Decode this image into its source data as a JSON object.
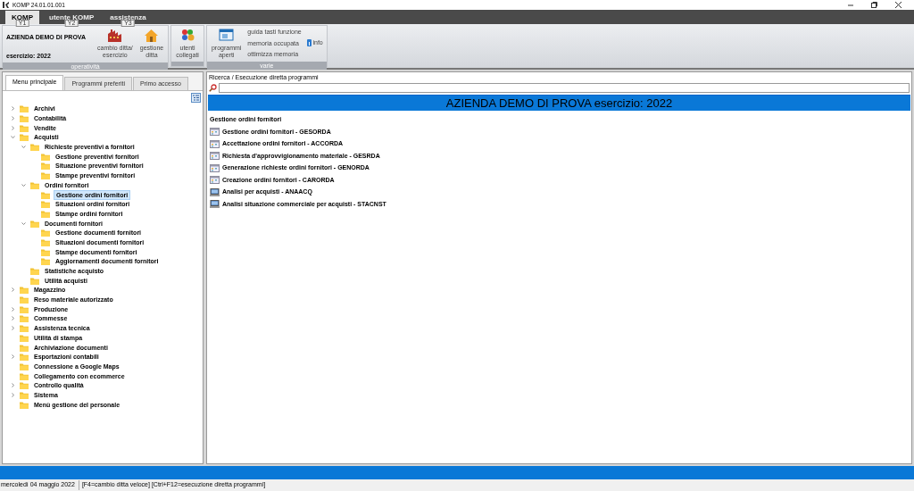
{
  "window": {
    "title": "KOMP 24.01.01.001"
  },
  "menu_tabs": [
    {
      "label": "KOMP",
      "key_tip": "Y1",
      "selected": true
    },
    {
      "label": "utente KOMP",
      "key_tip": "Y2",
      "selected": false
    },
    {
      "label": "assistenza",
      "key_tip": "Y3",
      "selected": false
    }
  ],
  "ribbon": {
    "company": "AZIENDA DEMO DI PROVA",
    "year": "esercizio: 2022",
    "groups": [
      {
        "caption": "operatività",
        "buttons": [
          {
            "kind": "factory",
            "label_lines": [
              "cambio ditta/",
              "esercizio"
            ]
          },
          {
            "kind": "house",
            "label_lines": [
              "gestione",
              "ditta"
            ]
          }
        ]
      },
      {
        "buttons": [
          {
            "kind": "users",
            "label_lines": [
              "utenti",
              "collegati"
            ]
          }
        ]
      },
      {
        "caption": "varie",
        "buttons": [
          {
            "kind": "window",
            "label_lines": [
              "programmi",
              "aperti"
            ]
          }
        ],
        "links": [
          "guida tasti funzione",
          "memoria occupata",
          "ottimizza memoria"
        ],
        "info": "info"
      }
    ]
  },
  "left_tabs": [
    {
      "label": "Menu principale",
      "selected": true
    },
    {
      "label": "Programmi preferiti",
      "selected": false
    },
    {
      "label": "Primo accesso",
      "selected": false
    }
  ],
  "tree": [
    {
      "label": "Archivi",
      "expanded": false,
      "selected": false
    },
    {
      "label": "Contabilità",
      "expanded": false,
      "selected": false
    },
    {
      "label": "Vendite",
      "expanded": false,
      "selected": false
    },
    {
      "label": "Acquisti",
      "expanded": true,
      "selected": false,
      "children": [
        {
          "label": "Richieste preventivi a fornitori",
          "expanded": true,
          "selected": false,
          "children": [
            {
              "label": "Gestione preventivi fornitori",
              "selected": false
            },
            {
              "label": "Situazione preventivi fornitori",
              "selected": false
            },
            {
              "label": "Stampe preventivi fornitori",
              "selected": false
            }
          ]
        },
        {
          "label": "Ordini fornitori",
          "expanded": true,
          "selected": false,
          "children": [
            {
              "label": "Gestione ordini fornitori",
              "selected": true
            },
            {
              "label": "Situazioni ordini fornitori",
              "selected": false
            },
            {
              "label": "Stampe ordini fornitori",
              "selected": false
            }
          ]
        },
        {
          "label": "Documenti fornitori",
          "expanded": true,
          "selected": false,
          "children": [
            {
              "label": "Gestione documenti fornitori",
              "selected": false
            },
            {
              "label": "Situazioni documenti fornitori",
              "selected": false
            },
            {
              "label": "Stampe documenti fornitori",
              "selected": false
            },
            {
              "label": "Aggiornamenti documenti fornitori",
              "selected": false
            }
          ]
        },
        {
          "label": "Statistiche acquisto",
          "selected": false
        },
        {
          "label": "Utilità acquisti",
          "selected": false
        }
      ]
    },
    {
      "label": "Magazzino",
      "expanded": false,
      "selected": false
    },
    {
      "label": "Reso materiale autorizzato",
      "selected": false
    },
    {
      "label": "Produzione",
      "expanded": false,
      "selected": false
    },
    {
      "label": "Commesse",
      "expanded": false,
      "selected": false
    },
    {
      "label": "Assistenza tecnica",
      "expanded": false,
      "selected": false
    },
    {
      "label": "Utilità di stampa",
      "selected": false
    },
    {
      "label": "Archiviazione documenti",
      "selected": false
    },
    {
      "label": "Esportazioni contabili",
      "expanded": false,
      "selected": false
    },
    {
      "label": "Connessione a Google Maps",
      "selected": false
    },
    {
      "label": "Collegamento con ecommerce",
      "selected": false
    },
    {
      "label": "Controllo qualità",
      "expanded": false,
      "selected": false
    },
    {
      "label": "Sistema",
      "expanded": false,
      "selected": false
    },
    {
      "label": "Menù gestione del personale",
      "selected": false
    }
  ],
  "search": {
    "label": "Ricerca / Esecuzione diretta programmi"
  },
  "banner": "AZIENDA DEMO DI PROVA  esercizio: 2022",
  "section_title": "Gestione ordini fornitori",
  "programs": [
    {
      "kind": "form",
      "label": "Gestione ordini fornitori - GESORDA"
    },
    {
      "kind": "form",
      "label": "Accettazione ordini fornitori - ACCORDA"
    },
    {
      "kind": "form",
      "label": "Richiesta d'approvvigionamento materiale - GESRDA"
    },
    {
      "kind": "form",
      "label": "Generazione richieste ordini fornitori - GENORDA"
    },
    {
      "kind": "form",
      "label": "Creazione ordini fornitori - CARORDA"
    },
    {
      "kind": "report",
      "label": "Analisi per acquisti - ANAACQ"
    },
    {
      "kind": "report",
      "label": "Analisi situazione commerciale per acquisti - STACNST"
    }
  ],
  "status_bar": {
    "date": "mercoledì 04 maggio 2022",
    "hints": "[F4=cambio ditta veloce] [Ctrl+F12=esecuzione diretta programmi]"
  }
}
